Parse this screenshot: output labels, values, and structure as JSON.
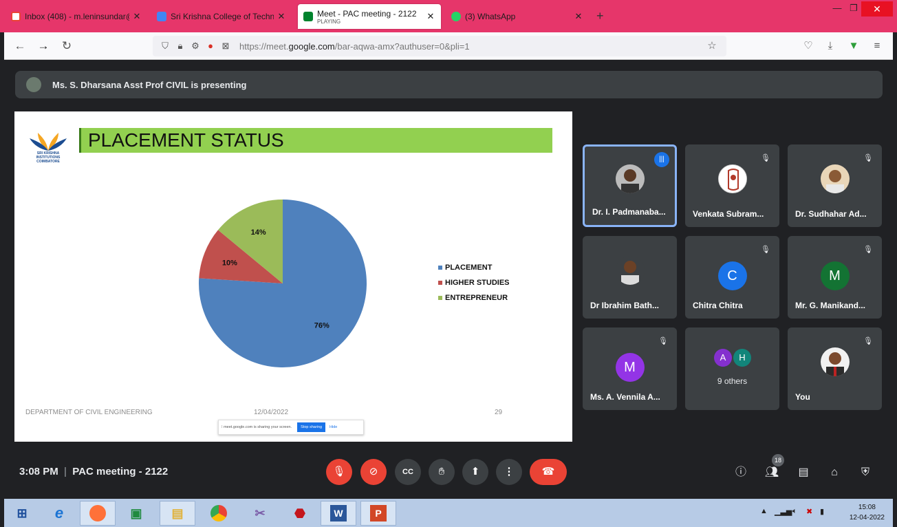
{
  "browser": {
    "tabs": [
      {
        "title": "Inbox (408) - m.leninsundar@sk",
        "favicon": "gmail-icon",
        "color": "#ea4335"
      },
      {
        "title": "Sri Krishna College of Technolo",
        "favicon": "calendar-icon",
        "color": "#4285f4"
      },
      {
        "title": "Meet - PAC meeting - 2122",
        "subtitle": "PLAYING",
        "favicon": "meet-icon",
        "color": "#00832d"
      },
      {
        "title": "(3) WhatsApp",
        "favicon": "whatsapp-icon",
        "color": "#25d366"
      }
    ],
    "url_prefix": "https://meet.",
    "url_domain": "google.com",
    "url_path": "/bar-aqwa-amx?authuser=0&pli=1",
    "accent": "#e6366a"
  },
  "meet": {
    "presenting_text": "Ms. S. Dharsana Asst Prof CIVIL is presenting",
    "slide": {
      "title": "PLACEMENT STATUS",
      "logo_text": "SRI KRISHNA INSTITUTIONS COIMBATORE",
      "footer_left": "DEPARTMENT OF CIVIL ENGINEERING",
      "footer_date": "12/04/2022",
      "footer_page": "29",
      "share_text": "meet.google.com is sharing your screen.",
      "share_stop": "Stop sharing",
      "share_hide": "Hide"
    },
    "participants": [
      {
        "name": "Dr. I. Padmanaba...",
        "speaking": true
      },
      {
        "name": "Venkata Subram..."
      },
      {
        "name": "Dr. Sudhahar Ad..."
      },
      {
        "name": "Dr Ibrahim Bath..."
      },
      {
        "name": "Chitra Chitra",
        "initial": "C",
        "color": "#1a73e8"
      },
      {
        "name": "Mr. G. Manikand...",
        "initial": "M",
        "color": "#137333"
      },
      {
        "name": "Ms. A. Vennila A...",
        "initial": "M",
        "color": "#9334e6"
      },
      {
        "name": "9 others",
        "initials": [
          "A",
          "H"
        ],
        "colors": [
          "#8430ce",
          "#12857a"
        ]
      },
      {
        "name": "You"
      }
    ],
    "time": "3:08 PM",
    "meeting_name": "PAC meeting - 2122",
    "people_count": "18"
  },
  "chart_data": {
    "type": "pie",
    "title": "PLACEMENT STATUS",
    "categories": [
      "PLACEMENT",
      "HIGHER STUDIES",
      "ENTREPRENEUR"
    ],
    "values": [
      76,
      10,
      14
    ],
    "labels": [
      "76%",
      "10%",
      "14%"
    ],
    "colors": [
      "#4f81bd",
      "#c0504d",
      "#9bbb59"
    ],
    "legend": "right"
  },
  "taskbar": {
    "time": "15:08",
    "date": "12-04-2022"
  }
}
